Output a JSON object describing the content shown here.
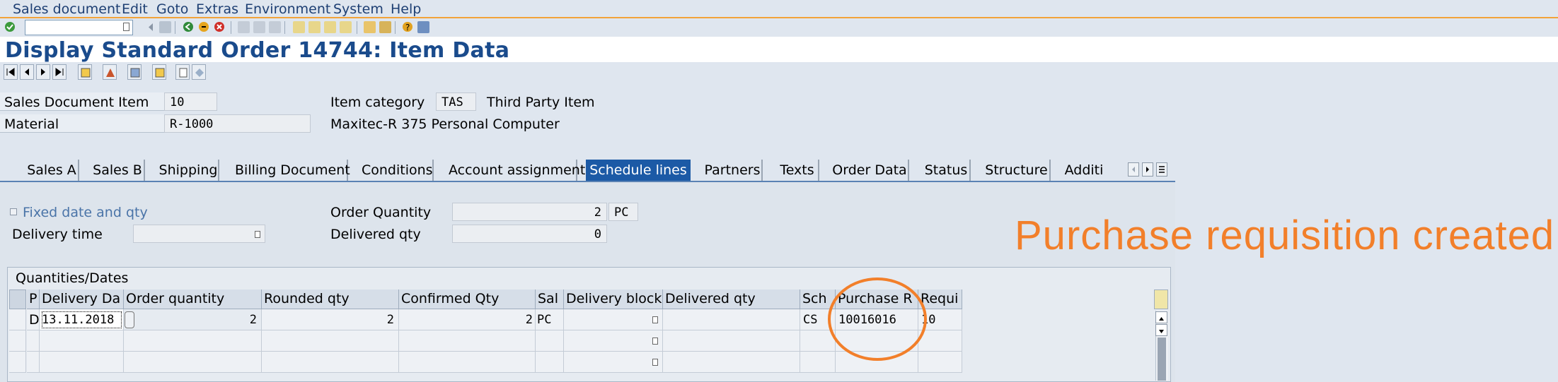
{
  "menu": [
    "Sales document",
    "Edit",
    "Goto",
    "Extras",
    "Environment",
    "System",
    "Help"
  ],
  "toolbar": {
    "command_value": ""
  },
  "title": "Display Standard Order 14744: Item Data",
  "header": {
    "item_label": "Sales Document Item",
    "item_value": "10",
    "material_label": "Material",
    "material_value": "R-1000",
    "item_category_label": "Item category",
    "item_category_value": "TAS",
    "item_category_desc": "Third Party Item",
    "material_desc": "Maxitec-R 375 Personal Computer"
  },
  "tabs": [
    {
      "label": "Sales A",
      "active": false
    },
    {
      "label": "Sales B",
      "active": false
    },
    {
      "label": "Shipping",
      "active": false
    },
    {
      "label": "Billing Document",
      "active": false
    },
    {
      "label": "Conditions",
      "active": false
    },
    {
      "label": "Account assignment",
      "active": false
    },
    {
      "label": "Schedule lines",
      "active": true
    },
    {
      "label": "Partners",
      "active": false
    },
    {
      "label": "Texts",
      "active": false
    },
    {
      "label": "Order Data",
      "active": false
    },
    {
      "label": "Status",
      "active": false
    },
    {
      "label": "Structure",
      "active": false
    },
    {
      "label": "Additi",
      "active": false
    }
  ],
  "schedule": {
    "fixed_date_label": "Fixed date and qty",
    "delivery_time_label": "Delivery time",
    "delivery_time_value": "",
    "order_qty_label": "Order Quantity",
    "order_qty_value": "2",
    "order_qty_unit": "PC",
    "delivered_qty_label": "Delivered qty",
    "delivered_qty_value": "0"
  },
  "group_title": "Quantities/Dates",
  "table": {
    "columns": [
      "P",
      "Delivery Da",
      "Order quantity",
      "Rounded qty",
      "Confirmed Qty",
      "Sal",
      "Delivery block",
      "Delivered qty",
      "Sch",
      "Purchase R",
      "Requi"
    ],
    "rows": [
      {
        "p": "D",
        "delivery_date": "13.11.2018",
        "order_qty": "2",
        "rounded_qty": "2",
        "confirmed_qty": "2",
        "sales_unit": "PC",
        "delivery_block": "",
        "delivered_qty": "",
        "sch": "CS",
        "purchase_req": "10016016",
        "req_item": "10"
      },
      {
        "p": "",
        "delivery_date": "",
        "order_qty": "",
        "rounded_qty": "",
        "confirmed_qty": "",
        "sales_unit": "",
        "delivery_block": "",
        "delivered_qty": "",
        "sch": "",
        "purchase_req": "",
        "req_item": ""
      },
      {
        "p": "",
        "delivery_date": "",
        "order_qty": "",
        "rounded_qty": "",
        "confirmed_qty": "",
        "sales_unit": "",
        "delivery_block": "",
        "delivered_qty": "",
        "sch": "",
        "purchase_req": "",
        "req_item": ""
      }
    ]
  },
  "annotation": "Purchase requisition created",
  "colors": {
    "accent": "#1c5aa6",
    "title": "#1a4b8c",
    "annotation": "#f27f2a"
  }
}
